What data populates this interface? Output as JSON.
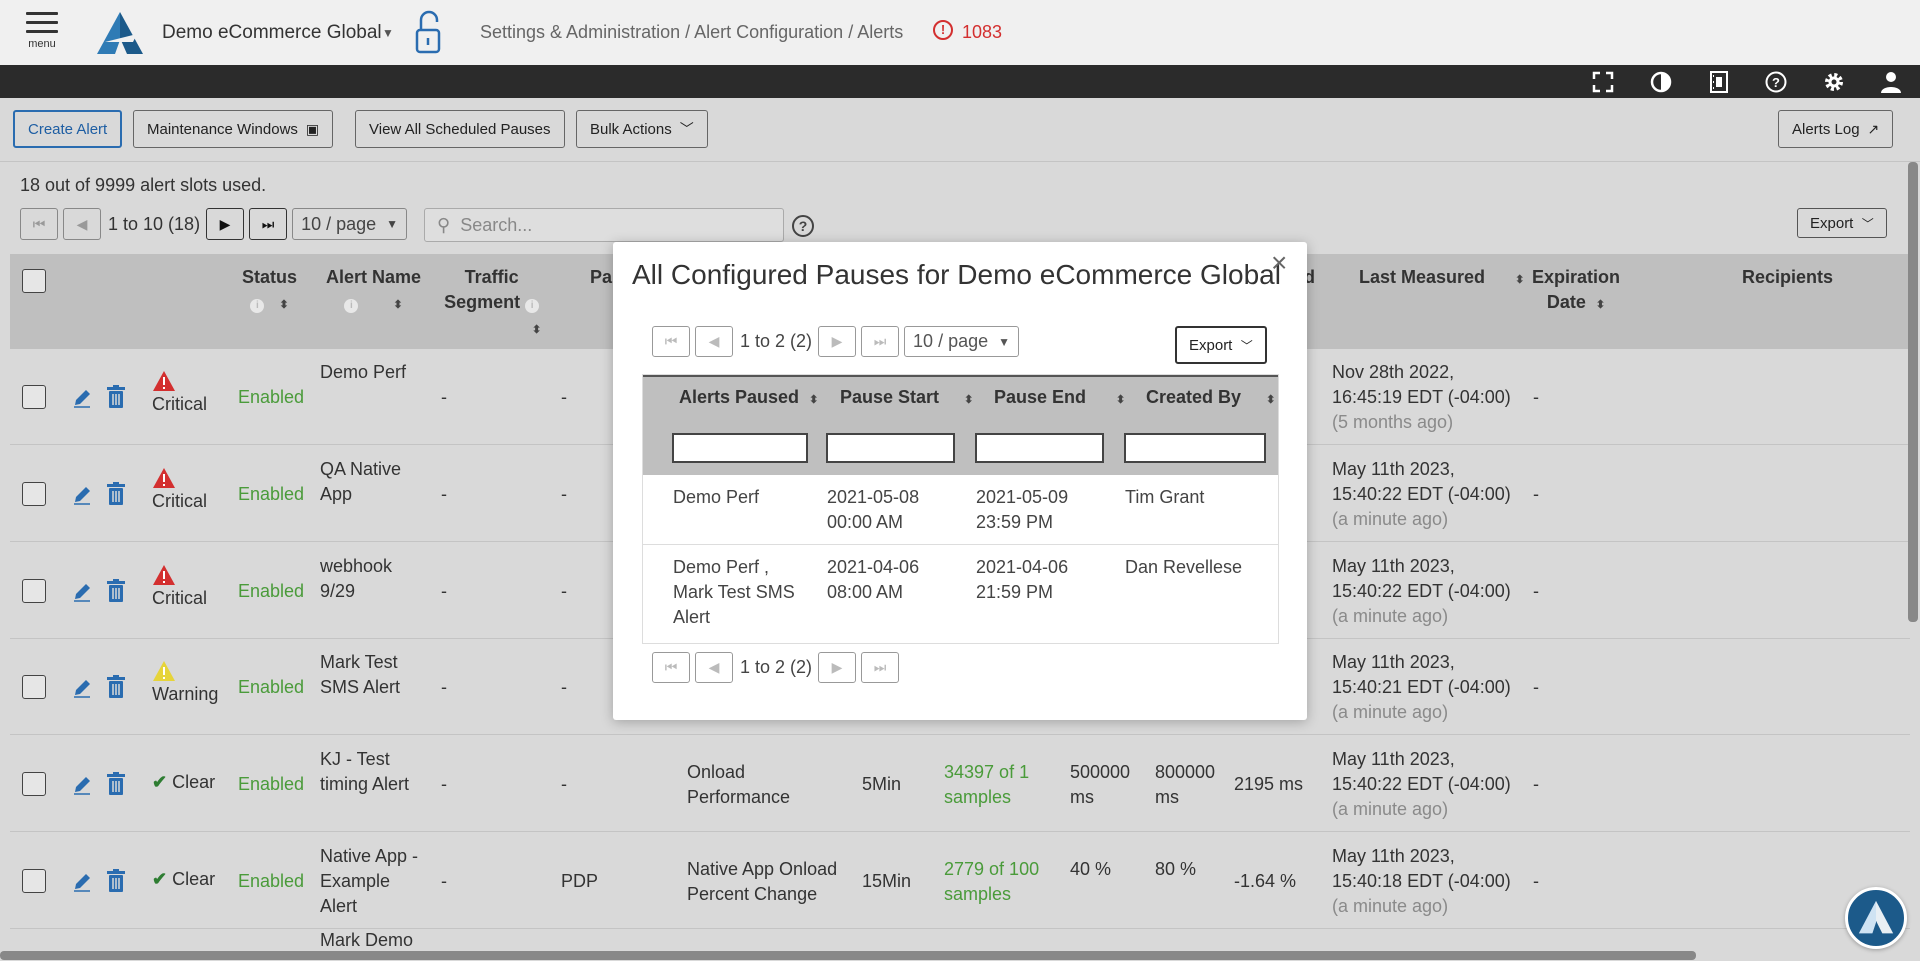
{
  "header": {
    "menu_label": "menu",
    "app_name": "Demo eCommerce Global",
    "breadcrumb": "Settings & Administration / Alert Configuration / Alerts",
    "error_count": "1083"
  },
  "toolbar": {
    "create_alert": "Create Alert",
    "maintenance_windows": "Maintenance Windows",
    "view_all_scheduled_pauses": "View All Scheduled Pauses",
    "bulk_actions": "Bulk Actions",
    "alerts_log": "Alerts Log"
  },
  "list": {
    "slots_text": "18 out of 9999 alert slots used.",
    "pager_text": "1 to 10 (18)",
    "page_size": "10 / page",
    "search_placeholder": "Search...",
    "export_label": "Export"
  },
  "table": {
    "columns": {
      "status": "Status",
      "alert_name": "Alert Name",
      "traffic_segment_1": "Traffic",
      "traffic_segment_2": "Segment",
      "page": "Pa",
      "measured_tail": "d",
      "last_measured": "Last Measured",
      "expiration_1": "Expiration",
      "expiration_2": "Date",
      "recipients": "Recipients"
    },
    "rows": [
      {
        "severity": "Critical",
        "status": "Enabled",
        "name_1": "Demo Perf",
        "name_2": "",
        "name_3": "",
        "segment": "-",
        "page": "-",
        "metric_1": "",
        "metric_2": "",
        "period": "",
        "samples_1": "",
        "samples_2": "",
        "warn_1": "",
        "warn_2": "",
        "crit_1": "",
        "crit_2": "",
        "value": "",
        "last_1": "Nov 28th 2022,",
        "last_2": "16:45:19 EDT (-04:00)",
        "last_3": "(5 months ago)",
        "expiration": "-"
      },
      {
        "severity": "Critical",
        "status": "Enabled",
        "name_1": "QA Native",
        "name_2": "App",
        "name_3": "",
        "segment": "-",
        "page": "-",
        "metric_1": "",
        "metric_2": "",
        "period": "",
        "samples_1": "",
        "samples_2": "",
        "warn_1": "",
        "warn_2": "",
        "crit_1": "",
        "crit_2": "",
        "value": "",
        "last_1": "May 11th 2023,",
        "last_2": "15:40:22 EDT (-04:00)",
        "last_3": "(a minute ago)",
        "expiration": "-"
      },
      {
        "severity": "Critical",
        "status": "Enabled",
        "name_1": "webhook",
        "name_2": "9/29",
        "name_3": "",
        "segment": "-",
        "page": "-",
        "metric_1": "",
        "metric_2": "",
        "period": "",
        "samples_1": "",
        "samples_2": "",
        "warn_1": "",
        "warn_2": "",
        "crit_1": "",
        "crit_2": "",
        "value": "",
        "last_1": "May 11th 2023,",
        "last_2": "15:40:22 EDT (-04:00)",
        "last_3": "(a minute ago)",
        "expiration": "-"
      },
      {
        "severity": "Warning",
        "status": "Enabled",
        "name_1": "Mark Test",
        "name_2": "SMS Alert",
        "name_3": "",
        "segment": "-",
        "page": "-",
        "metric_1": "",
        "metric_2": "",
        "period": "",
        "samples_1": "",
        "samples_2": "",
        "warn_1": "",
        "warn_2": "",
        "crit_1": "",
        "crit_2": "",
        "value": "",
        "last_1": "May 11th 2023,",
        "last_2": "15:40:21 EDT (-04:00)",
        "last_3": "(a minute ago)",
        "expiration": "-"
      },
      {
        "severity": "Clear",
        "status": "Enabled",
        "name_1": "KJ - Test",
        "name_2": "timing Alert",
        "name_3": "",
        "segment": "-",
        "page": "-",
        "metric_1": "Onload",
        "metric_2": "Performance",
        "period": "5Min",
        "samples_1": "34397 of 1",
        "samples_2": "samples",
        "warn_1": "500000",
        "warn_2": "ms",
        "crit_1": "800000",
        "crit_2": "ms",
        "value": "2195 ms",
        "last_1": "May 11th 2023,",
        "last_2": "15:40:22 EDT (-04:00)",
        "last_3": "(a minute ago)",
        "expiration": "-"
      },
      {
        "severity": "Clear",
        "status": "Enabled",
        "name_1": "Native App -",
        "name_2": "Example",
        "name_3": "Alert",
        "segment": "-",
        "page": "PDP",
        "metric_1": "Native App Onload",
        "metric_2": "Percent Change",
        "period": "15Min",
        "samples_1": "2779 of 100",
        "samples_2": "samples",
        "warn_1": "40 %",
        "warn_2": "",
        "crit_1": "80 %",
        "crit_2": "",
        "value": "-1.64 %",
        "last_1": "May 11th 2023,",
        "last_2": "15:40:18 EDT (-04:00)",
        "last_3": "(a minute ago)",
        "expiration": "-"
      },
      {
        "severity": "",
        "status": "",
        "name_1": "Mark Demo",
        "name_2": "",
        "name_3": "",
        "segment": "",
        "page": "",
        "metric_1": "",
        "metric_2": "",
        "period": "",
        "samples_1": "",
        "samples_2": "",
        "warn_1": "",
        "warn_2": "",
        "crit_1": "",
        "crit_2": "",
        "value": "",
        "last_1": "",
        "last_2": "",
        "last_3": "",
        "expiration": ""
      }
    ]
  },
  "modal": {
    "title": "All Configured Pauses for Demo eCommerce Global",
    "pager_text": "1 to 2 (2)",
    "page_size": "10 / page",
    "export_label": "Export",
    "columns": {
      "alerts_paused": "Alerts Paused",
      "pause_start": "Pause Start",
      "pause_end": "Pause End",
      "created_by": "Created By"
    },
    "rows": [
      {
        "alerts_1": "Demo Perf",
        "alerts_2": "",
        "alerts_3": "",
        "start_1": "2021-05-08",
        "start_2": "00:00 AM",
        "end_1": "2021-05-09",
        "end_2": "23:59 PM",
        "created_by": "Tim Grant"
      },
      {
        "alerts_1": "Demo Perf ,",
        "alerts_2": "Mark Test SMS",
        "alerts_3": "Alert",
        "start_1": "2021-04-06",
        "start_2": "08:00 AM",
        "end_1": "2021-04-06",
        "end_2": "21:59 PM",
        "created_by": "Dan Revellese"
      }
    ]
  },
  "colors": {
    "accent": "#2a6cb0",
    "enabled": "#4a9b3a",
    "critical": "#d32f2f",
    "warning": "#e6d43a",
    "clear": "#2e7d32"
  },
  "icons": [
    "menu-icon",
    "brand-logo",
    "unlock-icon",
    "error-icon",
    "fullscreen-icon",
    "contrast-icon",
    "film-icon",
    "help-icon",
    "gear-icon",
    "user-icon",
    "edit-icon",
    "trash-icon",
    "critical-icon",
    "warning-icon",
    "check-icon",
    "close-icon",
    "chat-icon"
  ]
}
